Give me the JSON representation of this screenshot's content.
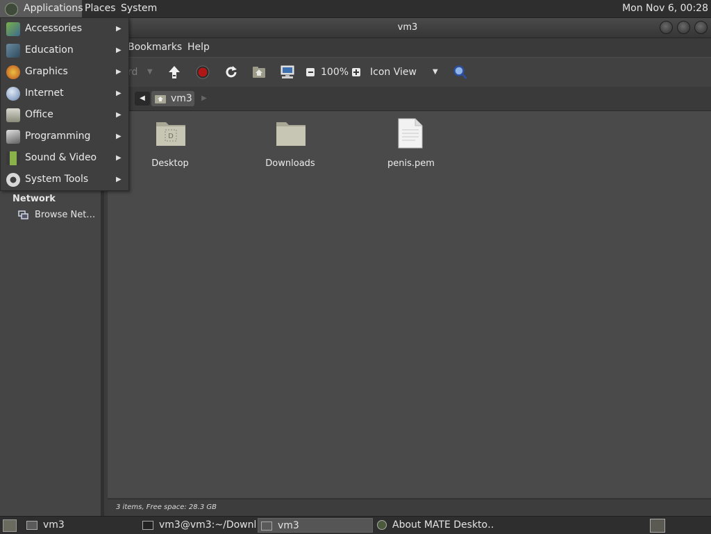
{
  "top_panel": {
    "applications": "Applications",
    "places": "Places",
    "system": "System",
    "clock": "Mon Nov  6, 00:28"
  },
  "apps_menu": {
    "items": [
      {
        "label": "Accessories",
        "icon": "accessories-icon"
      },
      {
        "label": "Education",
        "icon": "education-icon"
      },
      {
        "label": "Graphics",
        "icon": "graphics-icon"
      },
      {
        "label": "Internet",
        "icon": "internet-icon"
      },
      {
        "label": "Office",
        "icon": "office-icon"
      },
      {
        "label": "Programming",
        "icon": "programming-icon"
      },
      {
        "label": "Sound & Video",
        "icon": "sound-video-icon"
      },
      {
        "label": "System Tools",
        "icon": "system-tools-icon"
      }
    ]
  },
  "window": {
    "title": "vm3",
    "menubar": {
      "bookmarks": "Bookmarks",
      "help": "Help"
    },
    "toolbar": {
      "forward_partial": "rd",
      "zoom": "100%",
      "view_mode": "Icon View"
    },
    "location": {
      "current": "vm3"
    },
    "sidebar": {
      "network_header": "Network",
      "browse_network": "Browse Net…"
    },
    "files": [
      {
        "name": "Desktop",
        "type": "folder"
      },
      {
        "name": "Downloads",
        "type": "folder"
      },
      {
        "name": "penis.pem",
        "type": "file"
      }
    ],
    "status": "3 items, Free space: 28.3 GB"
  },
  "taskbar": {
    "tasks": [
      {
        "label": "vm3"
      },
      {
        "label": "vm3@vm3:~/Downl…"
      },
      {
        "label": "vm3"
      },
      {
        "label": "About MATE Deskto…"
      }
    ]
  },
  "colors": {
    "panel": "#2e2e2e",
    "content_bg": "#4a4a4a",
    "sidebar_bg": "#454545",
    "accent_active": "#5a5a5a"
  }
}
